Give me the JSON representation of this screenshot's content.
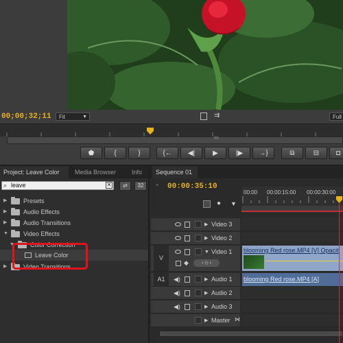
{
  "monitor": {
    "timecode": "00;00;32;11",
    "fit_value": "Fit",
    "full_value": "Full",
    "ruler_marker": "00",
    "controls": [
      "mark-in-button",
      "step-in-button",
      "step-out-button",
      "go-in-button",
      "step-back-button",
      "play-button",
      "step-forward-button",
      "go-out-button",
      "insert-button",
      "overwrite-button",
      "export-frame-button"
    ]
  },
  "project_panel": {
    "tabs": [
      "Project: Leave Color",
      "Media Browser",
      "Info"
    ],
    "search": {
      "value": "leave"
    },
    "bin_count": "32",
    "tree": [
      {
        "label": "Presets",
        "expanded": false
      },
      {
        "label": "Audio Effects",
        "expanded": false
      },
      {
        "label": "Audio Transitions",
        "expanded": false
      },
      {
        "label": "Video Effects",
        "expanded": true
      },
      {
        "label": "Color Correction",
        "expanded": true
      },
      {
        "label": "Leave Color"
      },
      {
        "label": "Video Transitions",
        "expanded": false
      }
    ]
  },
  "sequence_panel": {
    "tab": "Sequence 01",
    "timecode": "00:00:35:10",
    "ruler_labels": [
      "00:00",
      "00:00:15:00",
      "00:00:30:00"
    ],
    "v_label": "V",
    "a1_label": "A1",
    "tracks": [
      {
        "name": "Video 3",
        "kind": "video"
      },
      {
        "name": "Video 2",
        "kind": "video"
      },
      {
        "name": "Video 1",
        "kind": "video"
      },
      {
        "name": "Audio 1",
        "kind": "audio"
      },
      {
        "name": "Audio 2",
        "kind": "audio"
      },
      {
        "name": "Audio 3",
        "kind": "audio"
      },
      {
        "name": "Master",
        "kind": "master"
      }
    ],
    "video_clip": "blooming Red rose.MP4 [V]  Opacit",
    "audio_clip": "blooming Red rose.MP4 [A]"
  },
  "colors": {
    "timecode": "#e7b21f",
    "highlight_box": "#e0141a",
    "clip_video": "#8fa6c8",
    "clip_audio": "#4f6d97"
  }
}
